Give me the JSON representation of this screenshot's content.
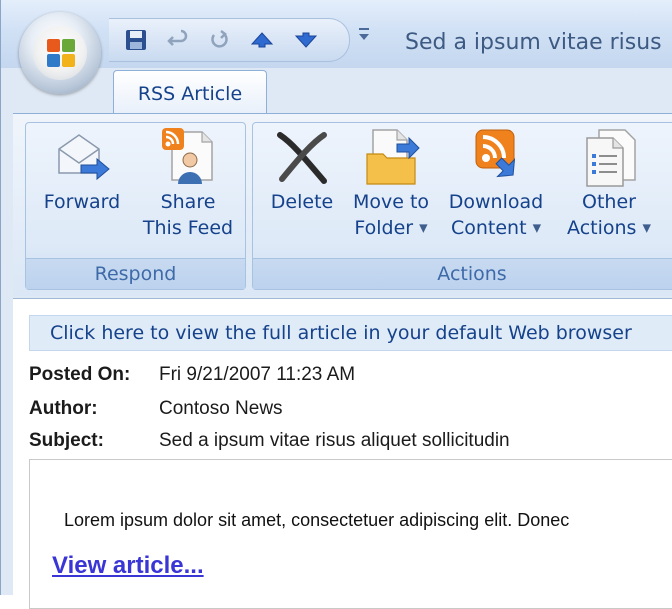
{
  "window": {
    "title": "Sed a ipsum vitae risus"
  },
  "quick_access": {
    "buttons": [
      {
        "icon": "save-icon"
      },
      {
        "icon": "undo-icon"
      },
      {
        "icon": "redo-icon"
      },
      {
        "icon": "previous-item-icon"
      },
      {
        "icon": "next-item-icon"
      }
    ],
    "customize_icon": "customize-qat-icon"
  },
  "tabs": [
    {
      "label": "RSS Article",
      "active": true
    }
  ],
  "ribbon": {
    "groups": [
      {
        "label": "Respond",
        "buttons": [
          {
            "line1": "Forward",
            "line2": "",
            "icon": "forward-icon"
          },
          {
            "line1": "Share",
            "line2": "This Feed",
            "icon": "share-feed-icon"
          }
        ]
      },
      {
        "label": "Actions",
        "buttons": [
          {
            "line1": "Delete",
            "line2": "",
            "icon": "delete-icon"
          },
          {
            "line1": "Move to",
            "line2": "Folder",
            "icon": "move-to-folder-icon",
            "dropdown": true
          },
          {
            "line1": "Download",
            "line2": "Content",
            "icon": "download-content-icon",
            "dropdown": true
          },
          {
            "line1": "Other",
            "line2": "Actions",
            "icon": "other-actions-icon",
            "dropdown": true
          }
        ]
      }
    ]
  },
  "article": {
    "infobar": "Click here to view the full article in your default Web browser",
    "fields": [
      {
        "name": "Posted On:",
        "value": "Fri 9/21/2007 11:23 AM"
      },
      {
        "name": "Author:",
        "value": "Contoso News"
      },
      {
        "name": "Subject:",
        "value": "Sed a ipsum vitae risus aliquet sollicitudin"
      }
    ],
    "body": "Lorem ipsum dolor sit amet, consectetuer adipiscing elit. Donec",
    "link": "View article..."
  },
  "colors": {
    "accent": "#15428b",
    "link": "#3a36d6",
    "group_label": "#3e6aa8"
  }
}
